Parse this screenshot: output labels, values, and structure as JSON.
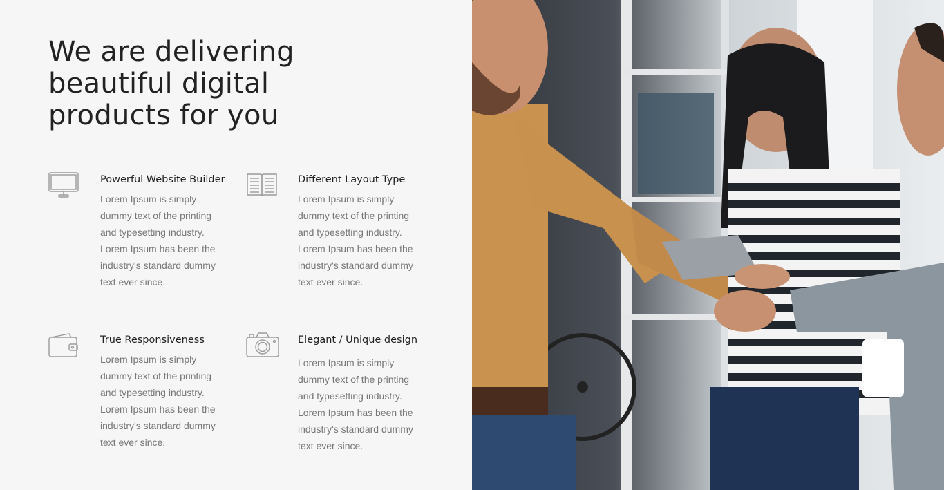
{
  "hero": {
    "heading_line1": "We are delivering",
    "heading_line2": "beautiful digital",
    "heading_line3": "products for you"
  },
  "features": [
    {
      "icon": "monitor-icon",
      "title": "Powerful Website Builder",
      "description": "Lorem Ipsum is simply dummy text of the printing and typesetting industry. Lorem Ipsum has been the industry's standard dummy text ever since."
    },
    {
      "icon": "book-icon",
      "title": "Different Layout Type",
      "description": "Lorem Ipsum is simply dummy text of the printing and typesetting industry. Lorem Ipsum has been the industry's standard dummy text ever since."
    },
    {
      "icon": "wallet-icon",
      "title": "True Responsiveness",
      "description": "Lorem Ipsum is simply dummy text of the printing and typesetting industry. Lorem Ipsum has been the industry's standard dummy text ever since."
    },
    {
      "icon": "camera-icon",
      "title": "Elegant / Unique design",
      "description": "Lorem Ipsum is simply dummy text of the printing and typesetting industry. Lorem Ipsum has been the industry's standard dummy text ever since."
    }
  ],
  "colors": {
    "panel_background": "#f6f6f7",
    "heading": "#222222",
    "body_text": "#777777",
    "icon_stroke": "#9a9a9a"
  }
}
